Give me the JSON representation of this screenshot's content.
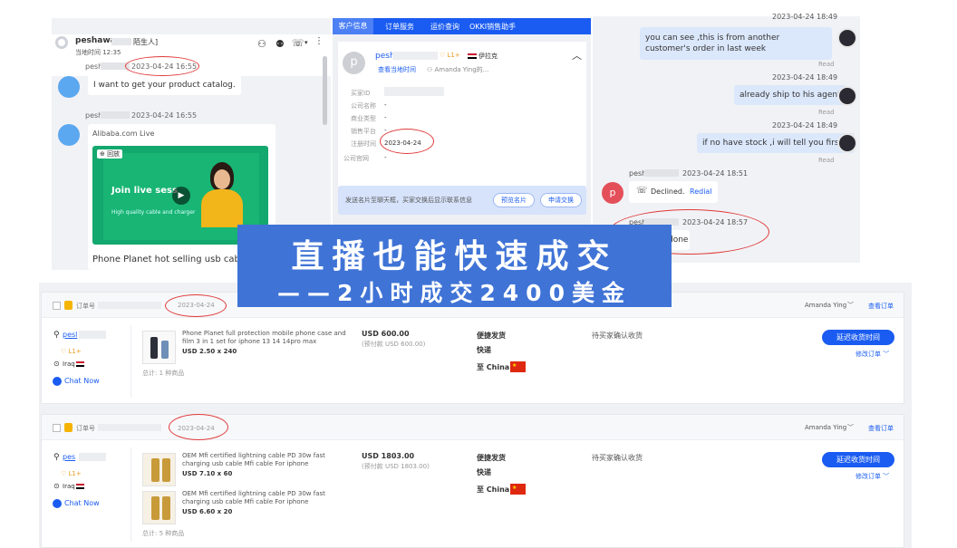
{
  "chat_left": {
    "contact_name": "peshawa",
    "contact_tag": "陌生人]",
    "local_time": "当地时间 12:35",
    "messages": [
      {
        "sender": "pesh",
        "time": "2023-04-24 16:55",
        "text": "I want to get your product catalog."
      },
      {
        "sender": "pesh",
        "time": "2023-04-24 16:55",
        "source": "Alibaba.com Live"
      }
    ],
    "live_card": {
      "replay_label": "回放",
      "title": "Join live sess",
      "subtitle": "High quality cable and charger",
      "caption": "Phone Planet hot selling usb cable a"
    }
  },
  "customer_panel": {
    "tabs": [
      "客户信息",
      "订单服务",
      "运价查询",
      "OKKI销售助手"
    ],
    "avatar_letter": "p",
    "name": "pesh",
    "level": "L1+",
    "country": "伊拉克",
    "local_time_link": "查看当地时间",
    "follower": "Amanda Ying的...",
    "fields": [
      {
        "label": "买家ID",
        "value": ""
      },
      {
        "label": "公司名称",
        "value": "-"
      },
      {
        "label": "商业类型",
        "value": "-"
      },
      {
        "label": "销售平台",
        "value": "-"
      },
      {
        "label": "注册时间",
        "value": "2023-04-24"
      },
      {
        "label": "公司官网",
        "value": "-"
      }
    ],
    "notice": "发送名片至聊天框，买家交换后显示联系信息",
    "preview_button": "预览名片",
    "apply_button": "申请交换"
  },
  "chat_right": {
    "items": [
      {
        "time": "2023-04-24 18:49",
        "text": "you can see ,this is from another customer's order in last week",
        "status": "Read"
      },
      {
        "time": "2023-04-24 18:49",
        "text": "already ship to his agent",
        "status": "Read"
      },
      {
        "time": "2023-04-24 18:49",
        "text": "if no have stock ,i will tell you firstly",
        "status": "Read"
      }
    ],
    "call": {
      "sender": "pesh",
      "time": "2023-04-24 18:51",
      "avatar_letter": "p",
      "status_text": "Declined.",
      "redial": "Redial"
    },
    "last": {
      "sender": "pesh",
      "time": "2023-04-24 18:57",
      "text": "done"
    }
  },
  "banner": {
    "title": "直播也能快速成交",
    "subtitle": "——2小时成交2400美金"
  },
  "orders": [
    {
      "order_label": "订单号",
      "date": "2023-04-24",
      "agent": "Amanda Ying",
      "view_order": "查看订单",
      "buyer": "pesl",
      "level": "L1+",
      "country": "Iraq",
      "chat": "Chat Now",
      "products": [
        {
          "title": "Phone Planet full protection mobile phone case and film 3 in 1 set for iphone 13 14 14pro max",
          "spec": "USD 2.50 x 240"
        }
      ],
      "total_items": "总计: 1 种商品",
      "amount": "USD 600.00",
      "prepaid": "(预付款 USD 600.00)",
      "ship1": "便捷发货",
      "ship2": "快递",
      "dest": "至 China",
      "status": "待买家确认收货",
      "action_button": "延迟收货时间",
      "modify": "修改订单"
    },
    {
      "order_label": "订单号",
      "date": "2023-04-24",
      "agent": "Amanda Ying",
      "view_order": "查看订单",
      "buyer": "pes",
      "level": "L1+",
      "country": "Iraq",
      "chat": "Chat Now",
      "products": [
        {
          "title": "OEM Mfi certified lightning cable PD 30w fast charging usb cable Mfi cable For iphone",
          "spec": "USD 7.10 x 60"
        },
        {
          "title": "OEM Mfi certified lightning cable PD 30w fast charging usb cable Mfi cable For iphone",
          "spec": "USD 6.60 x 20"
        }
      ],
      "total_items": "总计: 5 种商品",
      "amount": "USD 1803.00",
      "prepaid": "(预付款 USD 1803.00)",
      "ship1": "便捷发货",
      "ship2": "快递",
      "dest": "至 China",
      "status": "待买家确认收货",
      "action_button": "延迟收货时间",
      "modify": "修改订单"
    }
  ],
  "colors": {
    "accent": "#1a5cf1",
    "banner": "#3f73d6",
    "annotation": "#e03a3a"
  }
}
